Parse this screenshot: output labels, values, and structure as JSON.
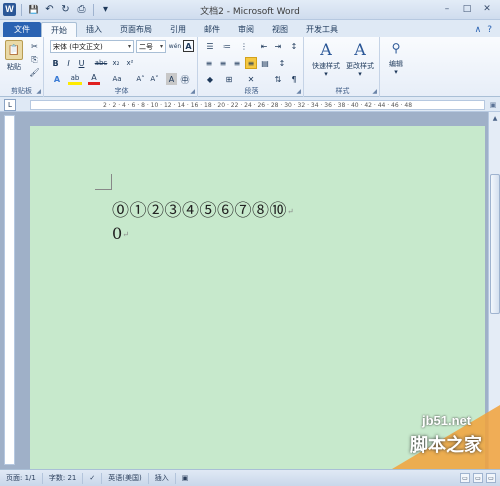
{
  "window": {
    "title": "文档2 - Microsoft Word",
    "app_icon": "W",
    "minimize": "–",
    "maximize": "□",
    "close": "✕"
  },
  "quick_access": {
    "save_icon": "💾",
    "undo_icon": "↶",
    "redo_icon": "↻",
    "print_icon": "⎙",
    "more_icon": "▾"
  },
  "tabs": {
    "file": "文件",
    "home": "开始",
    "insert": "插入",
    "layout": "页面布局",
    "references": "引用",
    "mailings": "邮件",
    "review": "审阅",
    "view": "视图",
    "developer": "开发工具",
    "collapse_icon": "∧",
    "help_icon": "?"
  },
  "ribbon": {
    "clipboard": {
      "paste_label": "粘贴",
      "group_label": "剪贴板"
    },
    "font": {
      "font_name": "宋体 (中文正文)",
      "font_size": "二号",
      "phonetic_icon": "wén",
      "border_icon": "A",
      "bold": "B",
      "italic": "I",
      "underline": "U",
      "strike": "abc",
      "subscript": "x₂",
      "superscript": "x²",
      "grow": "A˄",
      "shrink": "A˅",
      "case": "Aa",
      "clear_format": "A",
      "font_color": "A",
      "highlight": "ab",
      "group_label": "字体"
    },
    "paragraph": {
      "group_label": "段落"
    },
    "styles": {
      "quick_styles": "快速样式",
      "change_styles": "更改样式",
      "group_label": "样式"
    },
    "editing": {
      "label": "编辑"
    }
  },
  "ruler": {
    "tab_selector": "L",
    "ticks": "2 · 2 · 4 · 6 · 8 · 10 · 12 · 14 · 16 · 18 · 20 · 22 · 24 · 26 · 28 · 30 · 32 · 34 · 36 · 38 · 40 · 42 · 44 · 46 · 48"
  },
  "document": {
    "line1": "⓪①②③④⑤⑥⑦⑧⑩",
    "line2": "0",
    "paragraph_mark": "↵"
  },
  "statusbar": {
    "page": "页面: 1/1",
    "words": "字数: 21",
    "language": "英语(美国)",
    "insert_mode": "插入"
  },
  "watermark": {
    "url": "jb51.net",
    "text": "脚本之家"
  }
}
